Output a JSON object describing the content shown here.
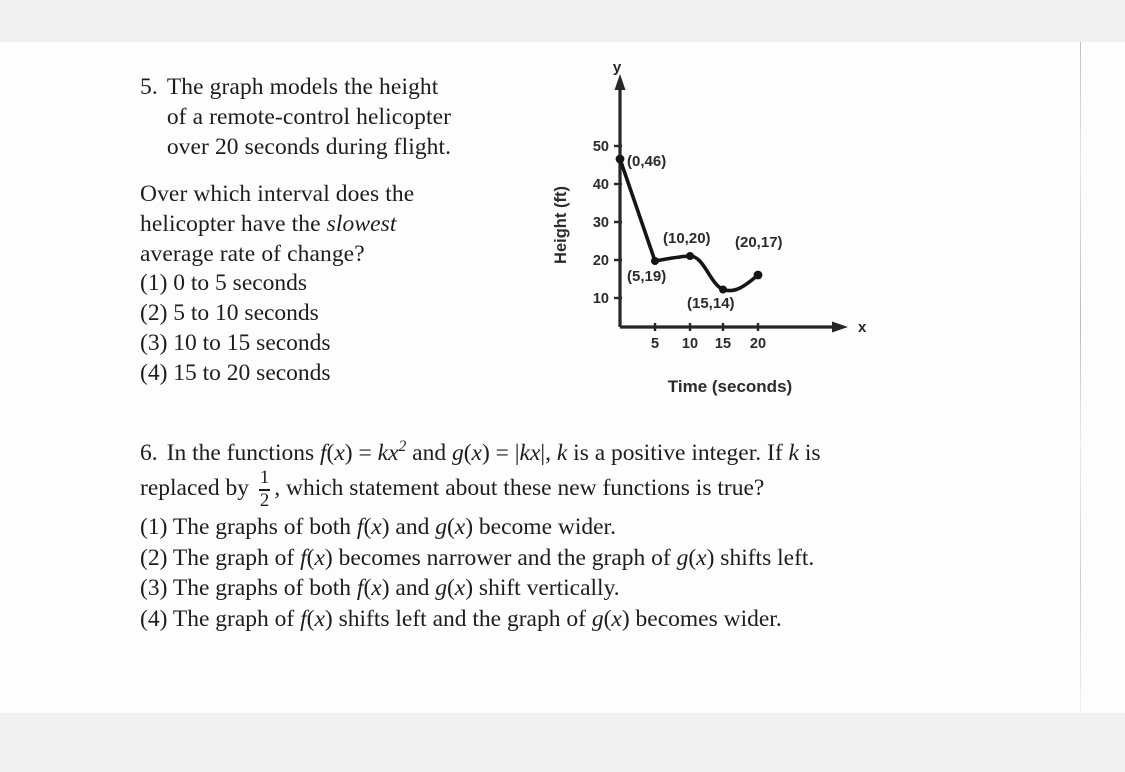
{
  "page": {
    "background_color": "#f1f1f1",
    "paper_color": "#fdfdfd",
    "ink_color": "#1d1d1f"
  },
  "question5": {
    "number": "5.",
    "stem_line1": "The graph models the height",
    "stem_line2": "of a remote-control helicopter",
    "stem_line3": "over 20 seconds during flight.",
    "prompt_line1": "Over which interval does the",
    "prompt_line2_pre": "helicopter have the ",
    "prompt_line2_italic": "slowest",
    "prompt_line3": "average rate of change?",
    "choices": [
      "(1) 0 to 5 seconds",
      "(2) 5 to 10 seconds",
      "(3) 10 to 15 seconds",
      "(4) 15 to 20 seconds"
    ]
  },
  "question6": {
    "number": "6.",
    "line1_a": "In the functions ",
    "line1_f": "f",
    "line1_b": "(",
    "line1_x1": "x",
    "line1_c": ") = ",
    "line1_k1": "k",
    "line1_x2": "x",
    "line1_exp": "2",
    "line1_d": " and ",
    "line1_g": "g",
    "line1_e": "(",
    "line1_x3": "x",
    "line1_f2": ") = |",
    "line1_k2": "k",
    "line1_x4": "x",
    "line1_g2": "|, ",
    "line1_k3": "k",
    "line1_h": " is a positive integer. If ",
    "line1_k4": "k",
    "line1_i": " is",
    "line2_a": "replaced by ",
    "frac_num": "1",
    "frac_den": "2",
    "line2_b": ", which statement about these new functions is true?",
    "choices": [
      {
        "parts": [
          {
            "t": "(1) The graphs of both ",
            "i": false
          },
          {
            "t": "f",
            "i": true
          },
          {
            "t": "(",
            "i": false
          },
          {
            "t": "x",
            "i": true
          },
          {
            "t": ") and ",
            "i": false
          },
          {
            "t": "g",
            "i": true
          },
          {
            "t": "(",
            "i": false
          },
          {
            "t": "x",
            "i": true
          },
          {
            "t": ") become wider.",
            "i": false
          }
        ]
      },
      {
        "parts": [
          {
            "t": "(2) The graph of ",
            "i": false
          },
          {
            "t": "f",
            "i": true
          },
          {
            "t": "(",
            "i": false
          },
          {
            "t": "x",
            "i": true
          },
          {
            "t": ") becomes narrower and the graph of ",
            "i": false
          },
          {
            "t": "g",
            "i": true
          },
          {
            "t": "(",
            "i": false
          },
          {
            "t": "x",
            "i": true
          },
          {
            "t": ") shifts left.",
            "i": false
          }
        ]
      },
      {
        "parts": [
          {
            "t": "(3) The graphs of both ",
            "i": false
          },
          {
            "t": "f",
            "i": true
          },
          {
            "t": "(",
            "i": false
          },
          {
            "t": "x",
            "i": true
          },
          {
            "t": ") and ",
            "i": false
          },
          {
            "t": "g",
            "i": true
          },
          {
            "t": "(",
            "i": false
          },
          {
            "t": "x",
            "i": true
          },
          {
            "t": ") shift vertically.",
            "i": false
          }
        ]
      },
      {
        "parts": [
          {
            "t": "(4) The graph of ",
            "i": false
          },
          {
            "t": "f",
            "i": true
          },
          {
            "t": "(",
            "i": false
          },
          {
            "t": "x",
            "i": true
          },
          {
            "t": ") shifts left and the graph of ",
            "i": false
          },
          {
            "t": "g",
            "i": true
          },
          {
            "t": "(",
            "i": false
          },
          {
            "t": "x",
            "i": true
          },
          {
            "t": ") becomes wider.",
            "i": false
          }
        ]
      }
    ]
  },
  "chart_data": {
    "type": "line",
    "title": "",
    "xlabel": "Time (seconds)",
    "ylabel": "Height (ft)",
    "x_axis_letter": "x",
    "y_axis_letter": "y",
    "x": [
      0,
      5,
      10,
      15,
      20
    ],
    "values": [
      46,
      19,
      20,
      14,
      17
    ],
    "point_labels": [
      "(0,46)",
      "(5,19)",
      "(10,20)",
      "(20,17)",
      "(15,14)"
    ],
    "xticks": [
      5,
      10,
      15,
      20
    ],
    "xtick_labels": [
      "5",
      "10",
      "15",
      "20"
    ],
    "yticks": [
      10,
      20,
      30,
      40,
      50
    ],
    "ytick_labels": [
      "10",
      "20",
      "30",
      "40",
      "50"
    ],
    "xlim": [
      0,
      24
    ],
    "ylim": [
      0,
      56
    ],
    "grid": false,
    "legend": "none",
    "line_color": "#151515",
    "marker": "filled-circle"
  }
}
